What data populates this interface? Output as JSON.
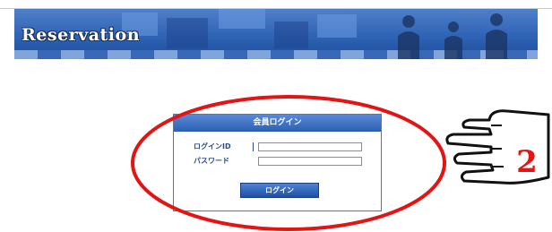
{
  "banner": {
    "title": "Reservation"
  },
  "login": {
    "header": "会員ログイン",
    "id_label": "ログインID",
    "password_label": "パスワード",
    "login_button": "ログイン"
  },
  "annotation": {
    "step_number": "2"
  }
}
